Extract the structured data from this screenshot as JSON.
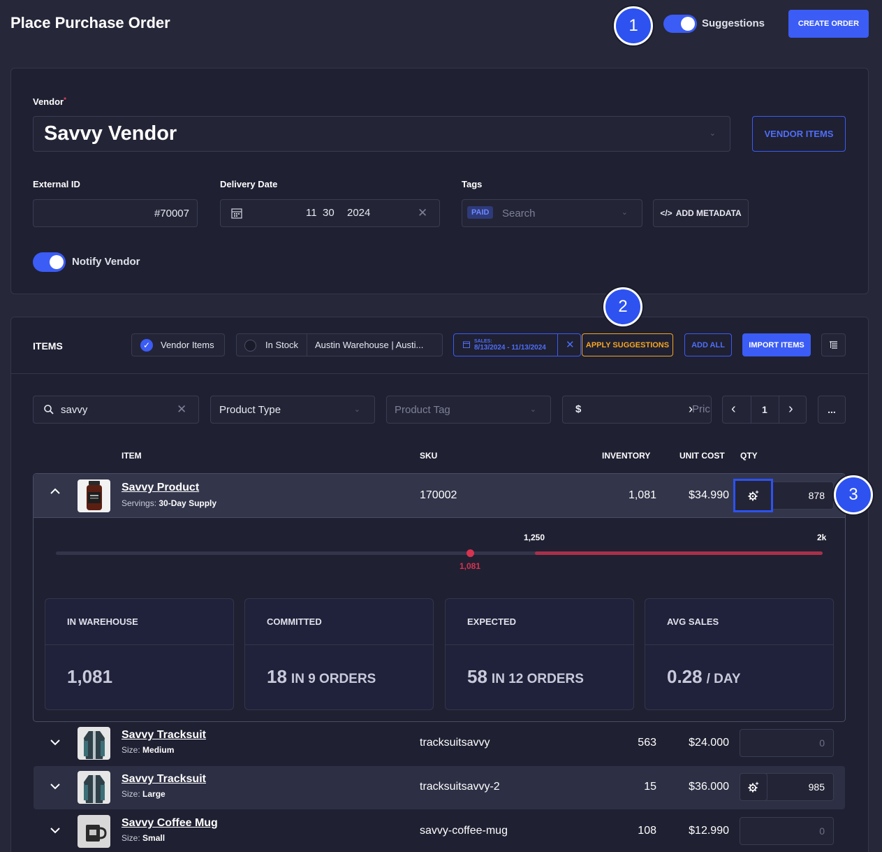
{
  "header": {
    "title": "Place Purchase Order",
    "suggestions_label": "Suggestions",
    "create_order_label": "CREATE ORDER",
    "callouts": [
      "1",
      "2",
      "3"
    ]
  },
  "order_form": {
    "vendor_label": "Vendor",
    "required_mark": "*",
    "vendor_value": "Savvy Vendor",
    "vendor_items_label": "VENDOR ITEMS",
    "external_id_label": "External ID",
    "external_id_value": "#70007",
    "delivery_date_label": "Delivery Date",
    "delivery_month": "11",
    "delivery_day": "30",
    "delivery_year": "2024",
    "tags_label": "Tags",
    "tag_chip": "PAID",
    "tags_placeholder": "Search",
    "add_metadata_label": "ADD METADATA",
    "notify_vendor_label": "Notify Vendor"
  },
  "items_toolbar": {
    "title": "ITEMS",
    "vendor_items_filter": "Vendor Items",
    "in_stock_filter": "In Stock",
    "warehouse_select": "Austin Warehouse | Austi...",
    "sales_caption": "SALES:",
    "sales_range": "8/13/2024 - 11/13/2024",
    "apply_suggestions_label": "APPLY SUGGESTIONS",
    "add_all_label": "ADD ALL",
    "import_items_label": "IMPORT ITEMS"
  },
  "filters": {
    "search_value": "savvy",
    "product_type": "Product Type",
    "product_tag": "Product Tag",
    "price_prefix": "$",
    "price_placeholder": "Pric",
    "page_number": "1",
    "more_label": "..."
  },
  "table": {
    "headers": {
      "item": "ITEM",
      "sku": "SKU",
      "inventory": "INVENTORY",
      "unit_cost": "UNIT COST",
      "qty": "QTY"
    },
    "rows": [
      {
        "name": "Savvy Product",
        "option_label": "Servings:",
        "option_value": "30-Day Supply",
        "sku": "170002",
        "inventory": "1,081",
        "unit_cost": "$34.990",
        "qty": "878"
      },
      {
        "name": "Savvy Tracksuit",
        "option_label": "Size:",
        "option_value": "Medium",
        "sku": "tracksuitsavvy",
        "inventory": "563",
        "unit_cost": "$24.000",
        "qty": "0"
      },
      {
        "name": "Savvy Tracksuit",
        "option_label": "Size:",
        "option_value": "Large",
        "sku": "tracksuitsavvy-2",
        "inventory": "15",
        "unit_cost": "$36.000",
        "qty": "985"
      },
      {
        "name": "Savvy Coffee Mug",
        "option_label": "Size:",
        "option_value": "Small",
        "sku": "savvy-coffee-mug",
        "inventory": "108",
        "unit_cost": "$12.990",
        "qty": "0"
      }
    ]
  },
  "expanded": {
    "slider_target": "1,250",
    "slider_max": "2k",
    "slider_current": "1,081",
    "slider_current_value": 1081,
    "slider_target_value": 1250,
    "slider_max_value": 2000,
    "stats": [
      {
        "title": "IN WAREHOUSE",
        "value": "1,081",
        "unit": ""
      },
      {
        "title": "COMMITTED",
        "value": "18",
        "unit": "IN 9 ORDERS"
      },
      {
        "title": "EXPECTED",
        "value": "58",
        "unit": "IN 12 ORDERS"
      },
      {
        "title": "AVG SALES",
        "value": "0.28",
        "unit": "/ DAY"
      }
    ]
  },
  "colors": {
    "accent": "#3b5cf5",
    "highlight_orange": "#f5a623",
    "slider_red": "#c8334a"
  }
}
